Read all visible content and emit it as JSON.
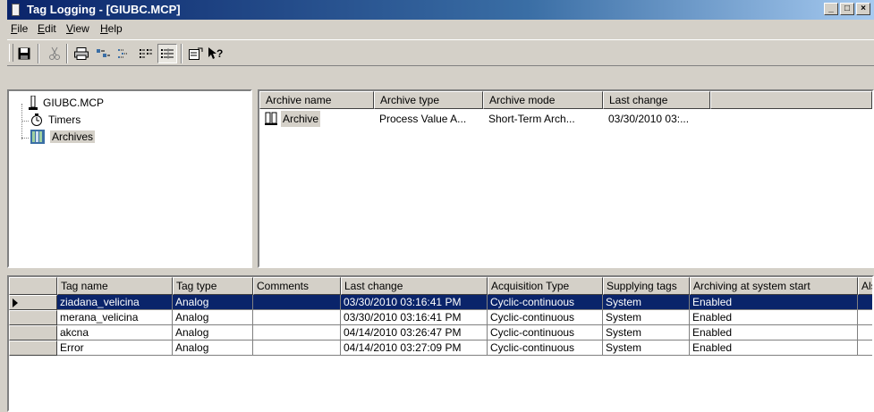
{
  "window": {
    "title": "Tag Logging - [GIUBC.MCP]",
    "min": "_",
    "max": "□",
    "close": "×"
  },
  "menu": [
    {
      "label": "File",
      "u": "F",
      "rest": "ile"
    },
    {
      "label": "Edit",
      "u": "E",
      "rest": "dit"
    },
    {
      "label": "View",
      "u": "V",
      "rest": "iew"
    },
    {
      "label": "Help",
      "u": "H",
      "rest": "elp"
    }
  ],
  "toolbar": {
    "icons": [
      "save-icon",
      "cut-icon",
      "print-icon",
      "large-icons-view-icon",
      "small-icons-view-icon",
      "list-view-icon",
      "details-view-icon",
      "properties-icon",
      "context-help-icon"
    ]
  },
  "tree": {
    "root": "GIUBC.MCP",
    "children": [
      "Timers",
      "Archives"
    ]
  },
  "archives": {
    "columns": [
      "Archive name",
      "Archive type",
      "Archive mode",
      "Last change"
    ],
    "rows": [
      [
        "Archive",
        "Process Value A...",
        "Short-Term Arch...",
        "03/30/2010 03:..."
      ]
    ]
  },
  "tags": {
    "columns": [
      "Tag name",
      "Tag type",
      "Comments",
      "Last change",
      "Acquisition Type",
      "Supplying tags",
      "Archiving at system start",
      "Als"
    ],
    "rows": [
      [
        "ziadana_velicina",
        "Analog",
        "",
        "03/30/2010 03:16:41 PM",
        "Cyclic-continuous",
        "System",
        "Enabled",
        ""
      ],
      [
        "merana_velicina",
        "Analog",
        "",
        "03/30/2010 03:16:41 PM",
        "Cyclic-continuous",
        "System",
        "Enabled",
        ""
      ],
      [
        "akcna",
        "Analog",
        "",
        "04/14/2010 03:26:47 PM",
        "Cyclic-continuous",
        "System",
        "Enabled",
        ""
      ],
      [
        "Error",
        "Analog",
        "",
        "04/14/2010 03:27:09 PM",
        "Cyclic-continuous",
        "System",
        "Enabled",
        ""
      ]
    ]
  },
  "colors": {
    "selection": "#0a246a",
    "face": "#d4d0c8"
  }
}
